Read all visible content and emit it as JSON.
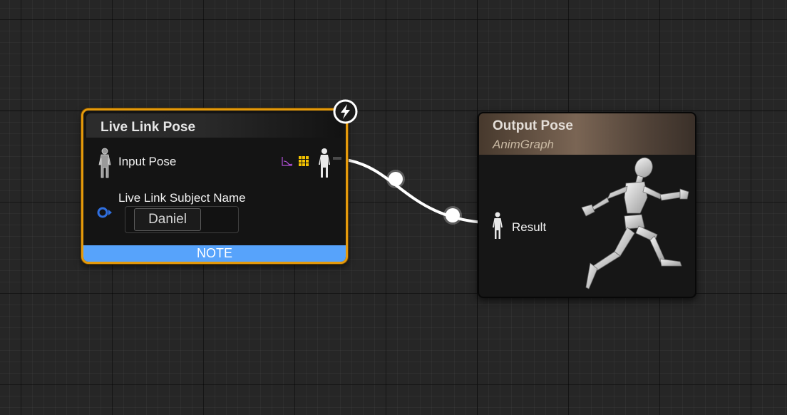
{
  "graph": {
    "background_color": "#262626",
    "grid_major_color": "#0f0f0f"
  },
  "live_link_node": {
    "title": "Live Link Pose",
    "selected_outline_color": "#e59a0b",
    "badge_icon": "lightning-bolt-icon",
    "input_pose_label": "Input Pose",
    "input_pose_icon": "mannequin-pose-icon",
    "output_pin_icons": [
      "curve-icon",
      "grid-icon",
      "mannequin-pose-icon"
    ],
    "subject_name_label": "Live Link Subject Name",
    "subject_name_pin_icon": "name-pin-icon",
    "subject_name_value": "Daniel",
    "note_label": "NOTE",
    "note_color": "#57a3fb"
  },
  "output_node": {
    "title": "Output Pose",
    "subtitle": "AnimGraph",
    "result_label": "Result",
    "result_pin_icon": "mannequin-pose-icon",
    "preview_icon": "running-mannequin-icon"
  },
  "wire": {
    "color": "#ffffff",
    "from": "live_link_node.output_pose",
    "to": "output_node.result"
  }
}
